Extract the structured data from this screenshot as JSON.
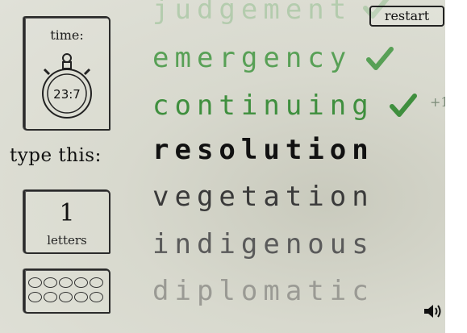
{
  "timer": {
    "label": "time:",
    "value": "23:7"
  },
  "prompt": {
    "label": "type this:"
  },
  "letters": {
    "count": "1",
    "label": "letters"
  },
  "lives": {
    "count": 10
  },
  "words": {
    "completed": [
      "judgement",
      "emergency",
      "continuing"
    ],
    "current": "resolution",
    "upcoming": [
      "vegetation",
      "indigenous",
      "diplomatic"
    ]
  },
  "bonus": "+1",
  "buttons": {
    "restart": "restart"
  },
  "icons": {
    "sound": "speaker-icon",
    "check": "check-icon",
    "stopwatch": "stopwatch-icon"
  },
  "colors": {
    "done": "#3f8f3e",
    "current": "#111111",
    "background": "#d8d9ce"
  }
}
